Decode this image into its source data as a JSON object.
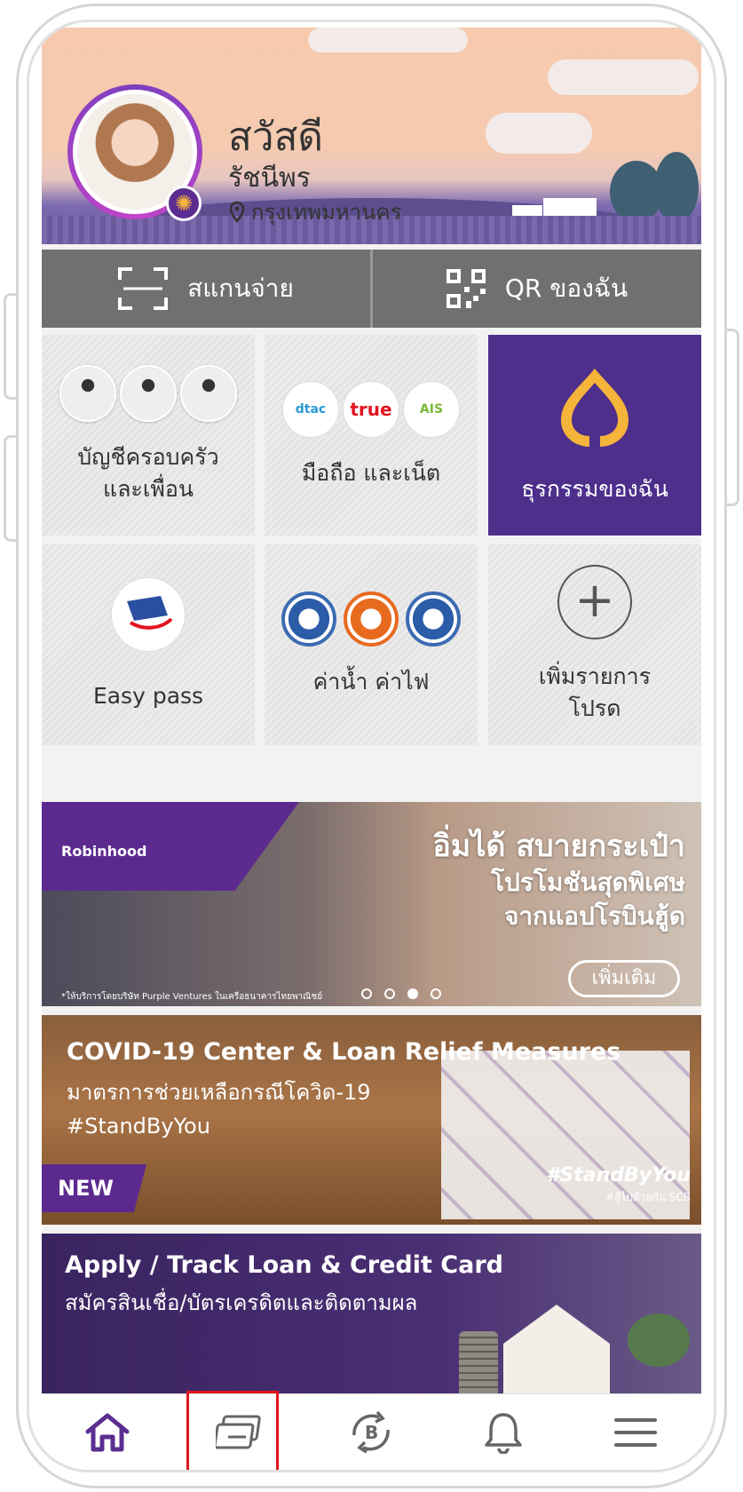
{
  "header": {
    "greeting": "สวัสดี",
    "user_name": "รัชนีพร",
    "location": "กรุงเทพมหานคร"
  },
  "quick_actions": {
    "scan_label": "สแกนจ่าย",
    "qr_label": "QR ของฉัน"
  },
  "tiles": [
    {
      "label_line1": "บัญชีครอบครัว",
      "label_line2": "และเพื่อน"
    },
    {
      "label_line1": "มือถือ และเน็ต",
      "brands": [
        "dtac",
        "true",
        "AIS"
      ]
    },
    {
      "label_line1": "ธุรกรรมของฉัน"
    },
    {
      "label_line1": "Easy pass"
    },
    {
      "label_line1": "ค่าน้ำ ค่าไฟ"
    },
    {
      "label_line1": "เพิ่มรายการ",
      "label_line2": "โปรด"
    }
  ],
  "banners": {
    "robinhood": {
      "logo": "Robinhood",
      "headline": "อิ่มได้ สบายกระเป๋า",
      "sub_line1": "โปรโมชันสุดพิเศษ",
      "sub_line2": "จากแอปโรบินฮู้ด",
      "button": "เพิ่มเติม",
      "footnote": "*ให้บริการโดยบริษัท Purple Ventures ในเครือธนาคารไทยพาณิชย์",
      "slide_count": 4,
      "active_slide": 3
    },
    "covid": {
      "title": "COVID-19 Center & Loan Relief Measures",
      "line2": "มาตรการช่วยเหลือกรณีโควิด-19",
      "line3": "#StandByYou",
      "badge": "NEW",
      "tag": "#StandByYou",
      "tag_sub": "#สู้ไปด้วยกัน SCB"
    },
    "loan": {
      "title": "Apply / Track Loan & Credit Card",
      "subtitle": "สมัครสินเชื่อ/บัตรเครดิตและติดตามผล"
    }
  },
  "nav": {
    "items": [
      "home-icon",
      "card-icon",
      "bitcoin-exchange-icon",
      "bell-icon",
      "menu-icon"
    ],
    "active": "home-icon",
    "highlighted": "card-icon"
  },
  "colors": {
    "brand_purple": "#4e2f8c",
    "scan_bar": "#707070",
    "highlight_red": "#e0161b",
    "gold": "#f5b43a"
  }
}
